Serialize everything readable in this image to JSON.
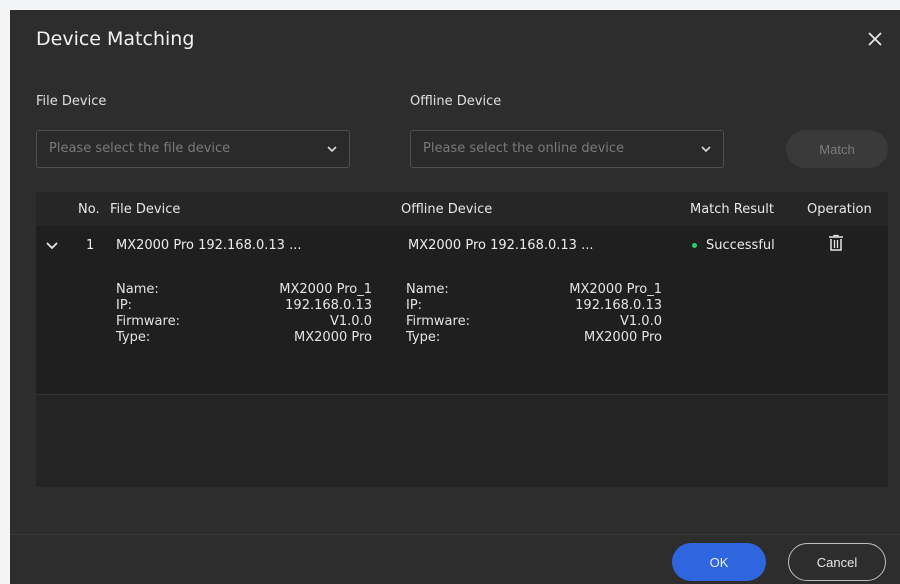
{
  "dialog": {
    "title": "Device Matching"
  },
  "selectors": {
    "file_label": "File Device",
    "file_placeholder": "Please select the file device",
    "offline_label": "Offline Device",
    "offline_placeholder": "Please select the online device",
    "match_label": "Match"
  },
  "table": {
    "headers": {
      "no": "No.",
      "file_device": "File Device",
      "offline_device": "Offline Device",
      "match_result": "Match Result",
      "operation": "Operation"
    },
    "rows": [
      {
        "no": "1",
        "file_device": "MX2000 Pro  192.168.0.13  ...",
        "offline_device": "MX2000 Pro  192.168.0.13  ...",
        "match_result": "Successful",
        "file_details": {
          "name_label": "Name:",
          "name": "MX2000 Pro_1",
          "ip_label": "IP:",
          "ip": "192.168.0.13",
          "firmware_label": "Firmware:",
          "firmware": "V1.0.0",
          "type_label": "Type:",
          "type": "MX2000 Pro"
        },
        "offline_details": {
          "name_label": "Name:",
          "name": "MX2000 Pro_1",
          "ip_label": "IP:",
          "ip": "192.168.0.13",
          "firmware_label": "Firmware:",
          "firmware": "V1.0.0",
          "type_label": "Type:",
          "type": "MX2000 Pro"
        }
      }
    ]
  },
  "footer": {
    "ok_label": "OK",
    "cancel_label": "Cancel"
  },
  "colors": {
    "background": "#2d2d2d",
    "accent": "#2f66e0",
    "success": "#2ecc71"
  }
}
